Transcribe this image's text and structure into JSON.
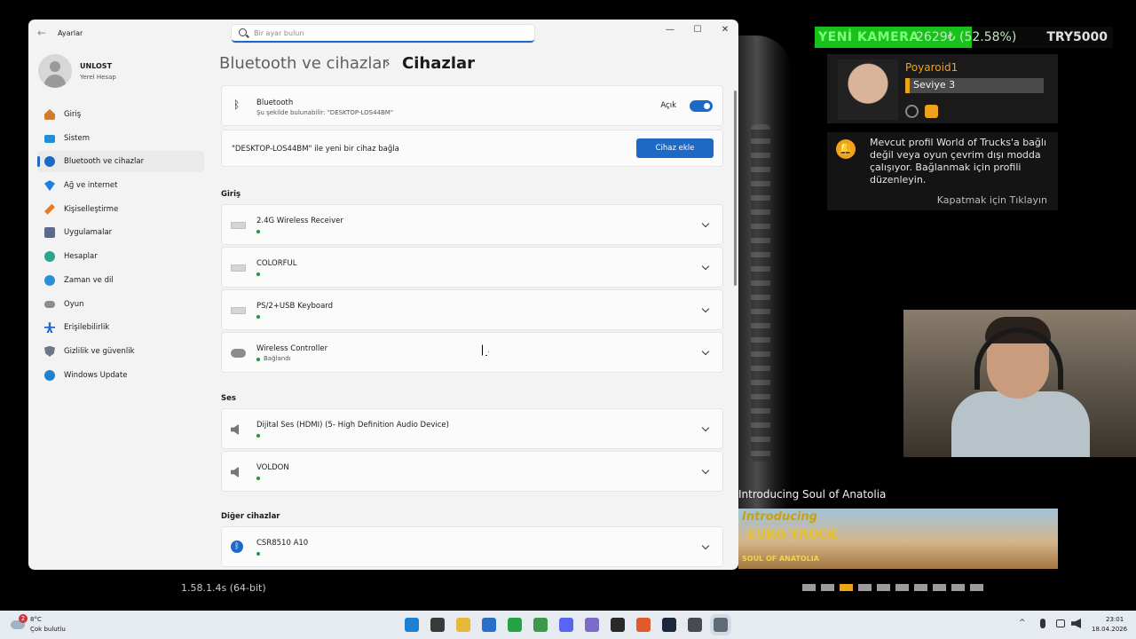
{
  "window": {
    "app_title": "Ayarlar",
    "search_placeholder": "Bir ayar bulun",
    "user": {
      "name": "UNLOST",
      "sub": "Yerel Hesap"
    },
    "nav": [
      {
        "label": "Giriş",
        "icon": "home-icon"
      },
      {
        "label": "Sistem",
        "icon": "system-icon"
      },
      {
        "label": "Bluetooth ve cihazlar",
        "icon": "bluetooth-icon",
        "active": true
      },
      {
        "label": "Ağ ve internet",
        "icon": "wifi-icon"
      },
      {
        "label": "Kişiselleştirme",
        "icon": "brush-icon"
      },
      {
        "label": "Uygulamalar",
        "icon": "apps-icon"
      },
      {
        "label": "Hesaplar",
        "icon": "accounts-icon"
      },
      {
        "label": "Zaman ve dil",
        "icon": "time-icon"
      },
      {
        "label": "Oyun",
        "icon": "game-icon"
      },
      {
        "label": "Erişilebilirlik",
        "icon": "access-icon"
      },
      {
        "label": "Gizlilik ve güvenlik",
        "icon": "shield-icon"
      },
      {
        "label": "Windows Update",
        "icon": "update-icon"
      }
    ],
    "breadcrumb": {
      "parent": "Bluetooth ve cihazlar",
      "separator": "›",
      "current": "Cihazlar"
    },
    "bluetooth": {
      "title": "Bluetooth",
      "subtitle": "Şu şekilde bulunabilir: \"DESKTOP-LOS44BM\"",
      "state_label": "Açık",
      "enabled": true
    },
    "add_device": {
      "text": "\"DESKTOP-LOS44BM\" ile yeni bir cihaz bağla",
      "button": "Cihaz ekle"
    },
    "sections": {
      "input": "Giriş",
      "audio": "Ses",
      "other": "Diğer cihazlar"
    },
    "input_devices": [
      {
        "name": "2.4G Wireless Receiver",
        "status": ""
      },
      {
        "name": "COLORFUL",
        "status": ""
      },
      {
        "name": "PS/2+USB Keyboard",
        "status": ""
      },
      {
        "name": "Wireless Controller",
        "status": "Bağlandı"
      }
    ],
    "audio_devices": [
      {
        "name": "Dijital Ses (HDMI) (5- High Definition Audio Device)"
      },
      {
        "name": "VOLDON"
      }
    ],
    "other_devices": [
      {
        "name": "CSR8510 A10"
      }
    ]
  },
  "overlay": {
    "ticker": {
      "label": "YENİ KAMERA",
      "amount": "2629₺ (52.58%)",
      "goal": "TRY5000",
      "progress": 0.5258
    },
    "profile": {
      "name": "Poyaroid1",
      "level": "Seviye 3"
    },
    "notification": {
      "text": "Mevcut profil World of Trucks'a bağlı değil veya oyun çevrim dışı modda çalışıyor. Bağlanmak için profili düzenleyin.",
      "close": "Kapatmak için Tıklayın"
    },
    "promo": {
      "title": "Introducing Soul of Anatolia",
      "logo_line1": "Introducing",
      "logo_line2": "EURO TRUCK",
      "logo_line3": "SOUL OF ANATOLIA",
      "active_dot": 2,
      "dot_count": 10
    },
    "version": "1.58.1.4s (64-bit)"
  },
  "taskbar": {
    "weather_badge": "2",
    "temperature": "8°C",
    "condition": "Çok bulutlu",
    "time": "23:01",
    "date": "18.04.2026",
    "tray_chevron": "^",
    "apps": [
      {
        "icon": "windows-start-icon",
        "color": "#1f7fd0"
      },
      {
        "icon": "search-icon",
        "color": "#3a3a3a"
      },
      {
        "icon": "file-explorer-icon",
        "color": "#e8b73a"
      },
      {
        "icon": "store-icon",
        "color": "#2a6fc6"
      },
      {
        "icon": "whatsapp-icon",
        "color": "#25a244"
      },
      {
        "icon": "chrome-icon",
        "color": "#3c9a4a"
      },
      {
        "icon": "discord-icon",
        "color": "#5865f2"
      },
      {
        "icon": "chrome-profile-icon",
        "color": "#7d6bc8"
      },
      {
        "icon": "obs-icon",
        "color": "#2a2a2a"
      },
      {
        "icon": "brave-icon",
        "color": "#e05a2b"
      },
      {
        "icon": "steam-icon",
        "color": "#1b2838"
      },
      {
        "icon": "game-app-icon",
        "color": "#4a4a4a"
      },
      {
        "icon": "settings-icon",
        "color": "#5f6b78",
        "active": true
      }
    ]
  }
}
